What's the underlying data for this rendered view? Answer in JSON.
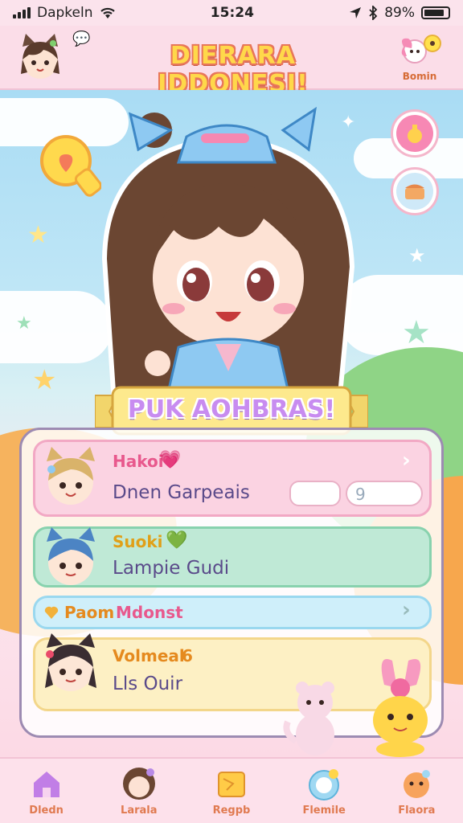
{
  "status_bar": {
    "carrier": "Dapkeln",
    "time": "15:24",
    "battery": "89%"
  },
  "header": {
    "title": "DIERARA IDDONESI!",
    "speech_icon": "speech-bubble-icon",
    "bomin_label": "Bomin"
  },
  "banner": {
    "text": "PUK AOHBRAS!"
  },
  "friends": [
    {
      "name": "Hakoi",
      "heart": "💗",
      "detail": "Dnen Garpeais",
      "name_color": "#e8598d",
      "input_value": "",
      "toggle_value": "9"
    },
    {
      "name": "Suoki",
      "heart": "💚",
      "detail": "Lampie Gudi",
      "name_color": "#e0a019"
    },
    {
      "name": "Paom",
      "detail": "Mdonst",
      "name_color": "#e58a1f",
      "detail_color": "#e8598d"
    },
    {
      "name": "Volmeal",
      "heart": "6",
      "detail": "Lls Ouir",
      "name_color": "#e58a1f"
    }
  ],
  "nav": {
    "items": [
      {
        "label": "Dledn",
        "icon": "home-icon"
      },
      {
        "label": "Larala",
        "icon": "avatar-icon"
      },
      {
        "label": "Regpb",
        "icon": "map-icon"
      },
      {
        "label": "Flemile",
        "icon": "pet-icon"
      },
      {
        "label": "Flaora",
        "icon": "settings-icon"
      }
    ]
  },
  "colors": {
    "accent_pink": "#f2a8c4",
    "title_yellow": "#ffd84a",
    "banner_purple": "#c88cf0",
    "nav_label": "#e07a50"
  }
}
